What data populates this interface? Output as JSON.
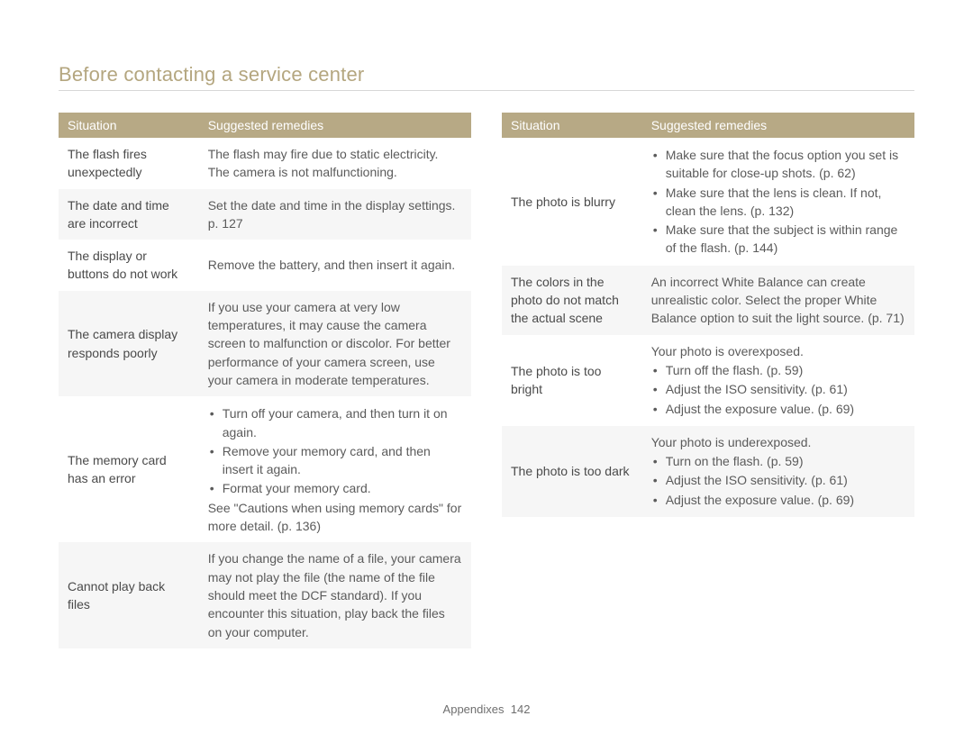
{
  "title": "Before contacting a service center",
  "headers": {
    "situation": "Situation",
    "remedies": "Suggested remedies"
  },
  "left_table": [
    {
      "situation": "The flash fires unexpectedly",
      "remedy_text": "The flash may fire due to static electricity. The camera is not malfunctioning."
    },
    {
      "situation": "The date and time are incorrect",
      "remedy_text": "Set the date and time in the display settings. p. 127"
    },
    {
      "situation": "The display or buttons do not work",
      "remedy_text": "Remove the battery, and then insert it again."
    },
    {
      "situation": "The camera display responds poorly",
      "remedy_text": "If you use your camera at very low temperatures, it may cause the camera screen to malfunction or discolor. For better performance of your camera screen, use your camera in moderate temperatures."
    },
    {
      "situation": "The memory card has an error",
      "remedy_bullets": [
        "Turn off your camera, and then turn it on again.",
        "Remove your memory card, and then insert it again.",
        "Format your memory card."
      ],
      "remedy_after": "See \"Cautions when using memory cards\" for more detail. (p. 136)"
    },
    {
      "situation": "Cannot play back files",
      "remedy_text": "If you change the name of a file, your camera may not play the file (the name of the file should meet the DCF standard). If you encounter this situation, play back the files on your computer."
    }
  ],
  "right_table": [
    {
      "situation": "The photo is blurry",
      "remedy_bullets": [
        "Make sure that the focus option you set is suitable for close-up shots. (p. 62)",
        "Make sure that the lens is clean. If not, clean the lens. (p. 132)",
        "Make sure that the subject is within range of the flash. (p. 144)"
      ]
    },
    {
      "situation": "The colors in the photo do not match the actual scene",
      "remedy_text": "An incorrect White Balance can create unrealistic color. Select the proper White Balance option to suit the light source. (p. 71)"
    },
    {
      "situation": "The photo is too bright",
      "remedy_before": "Your photo is overexposed.",
      "remedy_bullets": [
        "Turn off the flash. (p. 59)",
        "Adjust the ISO sensitivity. (p. 61)",
        "Adjust the exposure value. (p. 69)"
      ]
    },
    {
      "situation": "The photo is too dark",
      "remedy_before": "Your photo is underexposed.",
      "remedy_bullets": [
        "Turn on the flash. (p. 59)",
        "Adjust the ISO sensitivity. (p. 61)",
        "Adjust the exposure value. (p. 69)"
      ]
    }
  ],
  "footer": {
    "section": "Appendixes",
    "page": "142"
  }
}
